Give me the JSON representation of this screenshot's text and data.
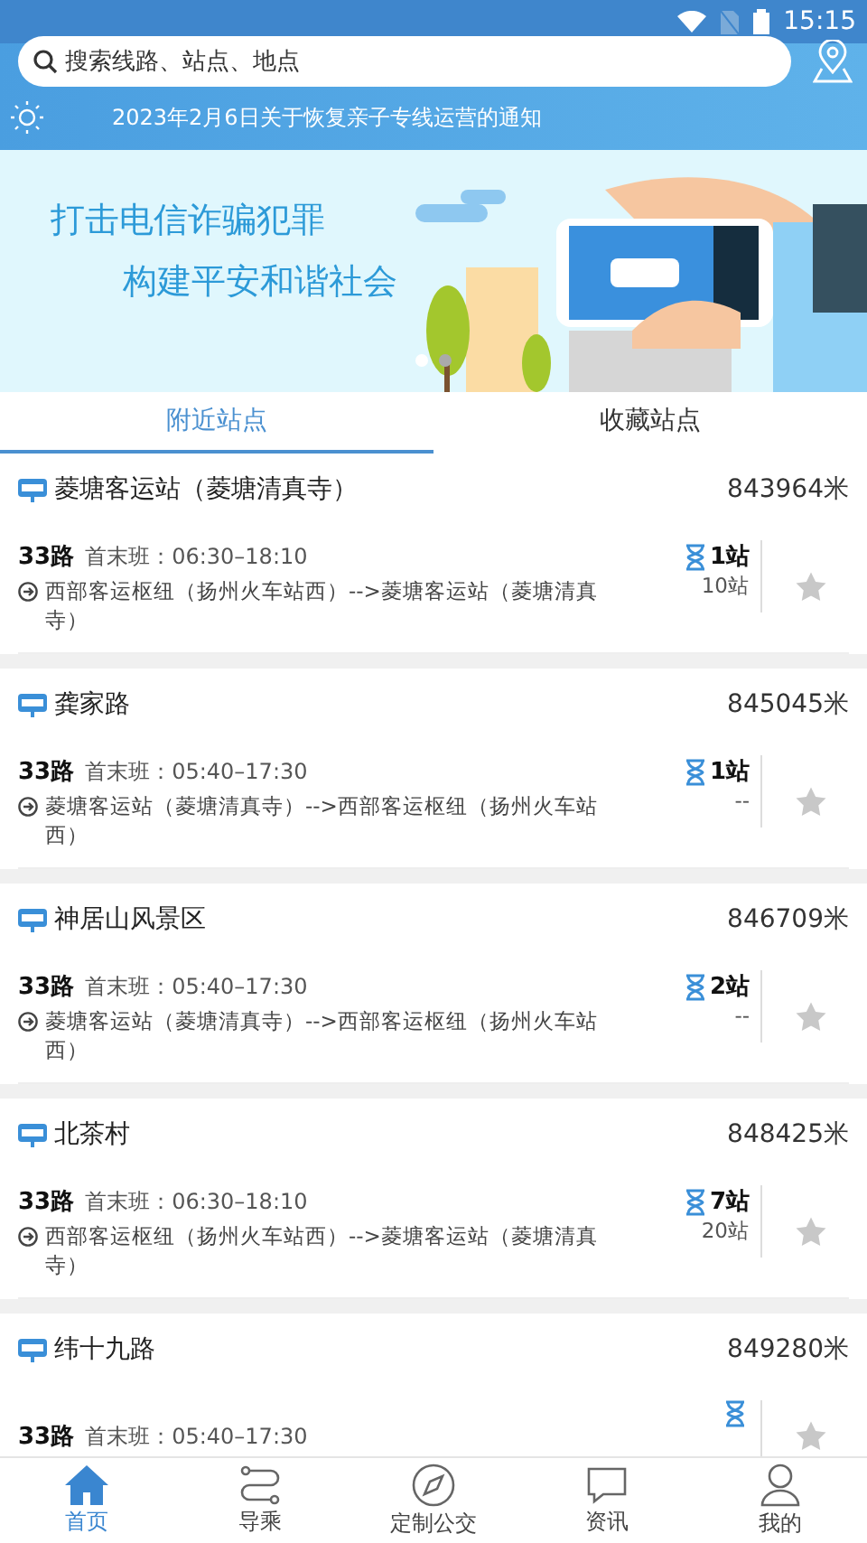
{
  "status_bar": {
    "time": "15:15"
  },
  "search": {
    "placeholder": "搜索线路、站点、地点"
  },
  "notice": "2023年2月6日关于恢复亲子专线运营的通知",
  "banner": {
    "line_1": "打击电信诈骗犯罪",
    "line_2": "构建平安和谐社会",
    "dots": [
      {
        "selected": true
      },
      {
        "selected": false
      }
    ]
  },
  "tabs": [
    {
      "label": "附近站点",
      "selected": true
    },
    {
      "label": "收藏站点",
      "selected": false
    }
  ],
  "stations": [
    {
      "name": "菱塘客运站（菱塘清真寺）",
      "distance": "843964米",
      "line": "33路",
      "hours": "首末班：06:30–18:10",
      "route": "西部客运枢纽（扬州火车站西）-->菱塘客运站（菱塘清真寺）",
      "next": "1站",
      "total": "10站",
      "favorite": false
    },
    {
      "name": "龚家路",
      "distance": "845045米",
      "line": "33路",
      "hours": "首末班：05:40–17:30",
      "route": "菱塘客运站（菱塘清真寺）-->西部客运枢纽（扬州火车站西）",
      "next": "1站",
      "total": "--",
      "favorite": false
    },
    {
      "name": "神居山风景区",
      "distance": "846709米",
      "line": "33路",
      "hours": "首末班：05:40–17:30",
      "route": "菱塘客运站（菱塘清真寺）-->西部客运枢纽（扬州火车站西）",
      "next": "2站",
      "total": "--",
      "favorite": false
    },
    {
      "name": "北茶村",
      "distance": "848425米",
      "line": "33路",
      "hours": "首末班：06:30–18:10",
      "route": "西部客运枢纽（扬州火车站西）-->菱塘客运站（菱塘清真寺）",
      "next": "7站",
      "total": "20站",
      "favorite": false
    },
    {
      "name": "纬十九路",
      "distance": "849280米",
      "line": "33路",
      "hours": "首末班：05:40–17:30",
      "favorite": false
    }
  ],
  "nav": [
    {
      "label": "首页",
      "selected": true
    },
    {
      "label": "导乘",
      "selected": false
    },
    {
      "label": "定制公交",
      "selected": false
    },
    {
      "label": "资讯",
      "selected": false
    },
    {
      "label": "我的",
      "selected": false
    }
  ]
}
